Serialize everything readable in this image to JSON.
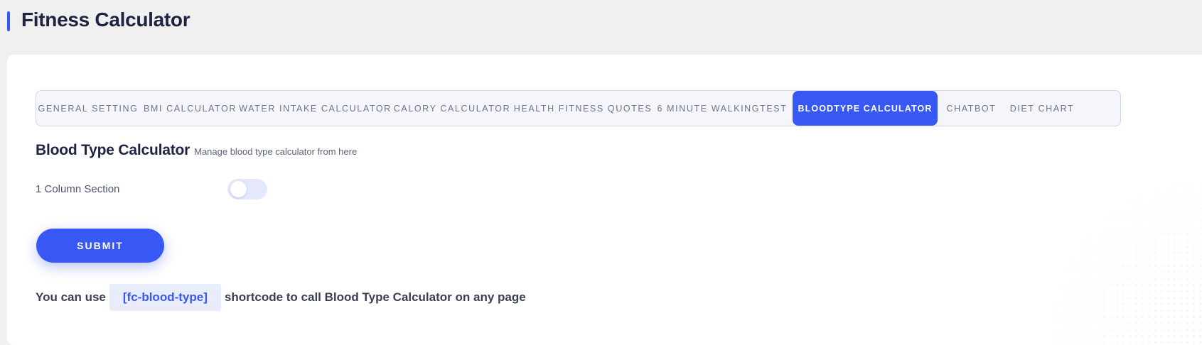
{
  "page": {
    "title": "Fitness Calculator"
  },
  "tabs": [
    {
      "label": "GENERAL SETTING",
      "active": false
    },
    {
      "label": "BMI CALCULATOR",
      "active": false
    },
    {
      "label": "WATER INTAKE CALCULATOR",
      "active": false
    },
    {
      "label": "CALORY CALCULATOR",
      "active": false
    },
    {
      "label": "HEALTH FITNESS QUOTES",
      "active": false
    },
    {
      "label": "6 MINUTE WALKINGTEST",
      "active": false
    },
    {
      "label": "BLOODTYPE CALCULATOR",
      "active": true
    },
    {
      "label": "CHATBOT",
      "active": false
    },
    {
      "label": "DIET CHART",
      "active": false
    }
  ],
  "section": {
    "title": "Blood Type Calculator",
    "subtitle": "Manage blood type calculator from here"
  },
  "settings": {
    "one_column_label": "1 Column Section",
    "one_column_enabled": false
  },
  "form": {
    "submit_label": "SUBMIT"
  },
  "usage": {
    "prefix": "You can use",
    "shortcode": "[fc-blood-type]",
    "suffix": "shortcode to call Blood Type Calculator on any page"
  },
  "colors": {
    "accent": "#3858f6",
    "background": "#f0f0f1",
    "card": "#ffffff",
    "title_text": "#1d2340"
  }
}
